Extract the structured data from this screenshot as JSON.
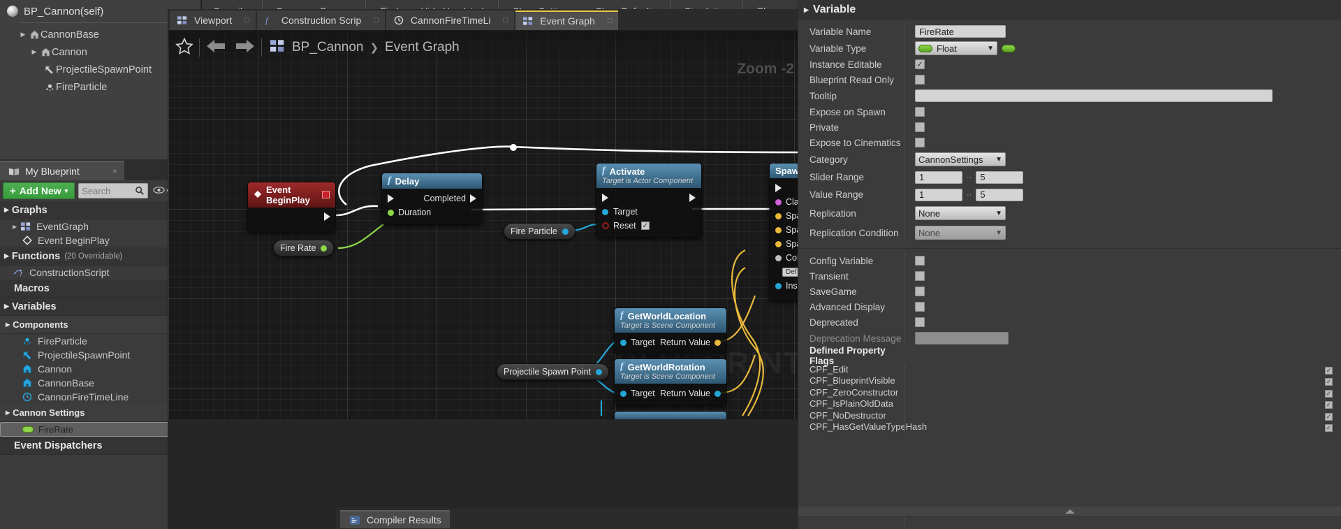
{
  "components_panel": {
    "root_label": "BP_Cannon(self)",
    "tree": [
      {
        "label": "CannonBase",
        "indent": 1,
        "icon": "component-icon",
        "arrow": true
      },
      {
        "label": "Cannon",
        "indent": 2,
        "icon": "component-icon",
        "arrow": true
      },
      {
        "label": "ProjectileSpawnPoint",
        "indent": 3,
        "icon": "arrow-icon",
        "arrow": false
      },
      {
        "label": "FireParticle",
        "indent": 3,
        "icon": "particle-icon",
        "arrow": false
      }
    ]
  },
  "my_blueprint": {
    "tab_label": "My Blueprint",
    "tab_close": "×",
    "add_new_label": "Add New",
    "add_new_plus": "+",
    "add_new_caret": "▾",
    "search_placeholder": "Search",
    "sections": [
      {
        "title": "Graphs",
        "sub": "",
        "plus": "+"
      },
      {
        "title": "Functions",
        "sub": "(20 Overridable)",
        "plus": "+"
      },
      {
        "title": "Macros",
        "sub": "",
        "plus": "+"
      },
      {
        "title": "Variables",
        "sub": "",
        "plus": "+"
      },
      {
        "title": "Event Dispatchers",
        "sub": "",
        "plus": "+"
      }
    ],
    "graphs": [
      {
        "label": "EventGraph",
        "icon": "graph-icon",
        "indent": 1
      },
      {
        "label": "Event BeginPlay",
        "icon": "event-node-icon",
        "indent": 2
      }
    ],
    "functions": [
      {
        "label": "ConstructionScript",
        "icon": "function-icon",
        "indent": 1
      }
    ],
    "components_group_label": "Components",
    "components_vars": [
      {
        "label": "FireParticle",
        "icon": "particle-icon"
      },
      {
        "label": "ProjectileSpawnPoint",
        "icon": "arrow-icon"
      },
      {
        "label": "Cannon",
        "icon": "component-icon"
      },
      {
        "label": "CannonBase",
        "icon": "component-icon"
      },
      {
        "label": "CannonFireTimeLine",
        "icon": "timeline-icon"
      }
    ],
    "cannon_settings_label": "Cannon Settings",
    "cannon_settings_vars": [
      {
        "label": "FireRate",
        "icon": "float-pill-icon",
        "selected": true,
        "eye": "eye-icon"
      }
    ]
  },
  "toolbar": {
    "items": [
      "Compile",
      "Save",
      "Browse",
      "Find",
      "Hide Unrelated",
      "Class Settings",
      "Class Defaults",
      "Simulation",
      "Play"
    ]
  },
  "graph_tabs": [
    {
      "label": "Viewport",
      "icon": "viewport-icon",
      "active": false
    },
    {
      "label": "Construction Scrip",
      "icon": "function-icon",
      "active": false
    },
    {
      "label": "CannonFireTimeLi",
      "icon": "clock-icon",
      "active": false
    },
    {
      "label": "Event Graph",
      "icon": "graph-icon",
      "active": true
    }
  ],
  "graph_toolbar": {
    "favorite_icon": "star-icon",
    "back_icon": "arrow-left-icon",
    "forward_icon": "arrow-right-icon",
    "breadcrumb_icon": "graph-icon",
    "breadcrumb": [
      "BP_Cannon",
      "Event Graph"
    ],
    "breadcrumb_sep": "❯",
    "zoom_label": "Zoom -2",
    "watermark": "BLUEPRINT"
  },
  "nodes": {
    "event_begin_play": {
      "title": "Event BeginPlay",
      "icon": "event-diamond-icon",
      "badge": "stop-badge",
      "header_color": "#8d2222"
    },
    "delay": {
      "title": "Delay",
      "icon": "function-f-icon",
      "clock_icon": "clock-icon",
      "header_color": "#3f6f8e",
      "pins_out": [
        "Completed"
      ],
      "pins_in": [
        "Duration"
      ]
    },
    "activate": {
      "title": "Activate",
      "subtitle": "Target is Actor Component",
      "icon": "function-f-icon",
      "header_color": "#3f6f8e",
      "pins": [
        {
          "label": "Target",
          "type": "object"
        },
        {
          "label": "Reset",
          "type": "bool",
          "checked": true
        }
      ]
    },
    "spawn_actor": {
      "title": "Spaw",
      "header_color": "#3f6f8e",
      "pins": [
        "Class",
        "Spaw",
        "Spaw",
        "Spaw",
        "Collis",
        "Insta"
      ],
      "dropdown_value": "Def"
    },
    "get_world_location": {
      "title": "GetWorldLocation",
      "subtitle": "Target is Scene Component",
      "icon": "function-f-icon",
      "header_color": "#3f6f8e",
      "pin_in": "Target",
      "pin_out": "Return Value"
    },
    "get_world_rotation": {
      "title": "GetWorldRotation",
      "subtitle": "Target is Scene Component",
      "icon": "function-f-icon",
      "header_color": "#3f6f8e",
      "pin_in": "Target",
      "pin_out": "Return Value"
    },
    "fire_rate_bubble": {
      "label": "Fire Rate"
    },
    "fire_particle_bubble": {
      "label": "Fire Particle"
    },
    "projectile_spawn_point_bubble": {
      "label": "Projectile Spawn Point"
    }
  },
  "compiler_results": {
    "tab_label": "Compiler Results",
    "icon": "results-icon"
  },
  "details": {
    "section_title": "Variable",
    "rows": [
      {
        "label": "Variable Name",
        "kind": "text",
        "value": "FireRate"
      },
      {
        "label": "Variable Type",
        "kind": "type",
        "value": "Float"
      },
      {
        "label": "Instance Editable",
        "kind": "check",
        "checked": true
      },
      {
        "label": "Blueprint Read Only",
        "kind": "check",
        "checked": false
      },
      {
        "label": "Tooltip",
        "kind": "text",
        "value": ""
      },
      {
        "label": "Expose on Spawn",
        "kind": "check",
        "checked": false
      },
      {
        "label": "Private",
        "kind": "check",
        "checked": false
      },
      {
        "label": "Expose to Cinematics",
        "kind": "check",
        "checked": false
      },
      {
        "label": "Category",
        "kind": "select",
        "value": "CannonSettings"
      },
      {
        "label": "Slider Range",
        "kind": "range",
        "min": "1",
        "max": "5"
      },
      {
        "label": "Value Range",
        "kind": "range",
        "min": "1",
        "max": "5"
      },
      {
        "label": "Replication",
        "kind": "select",
        "value": "None"
      },
      {
        "label": "Replication Condition",
        "kind": "select-disabled",
        "value": "None"
      }
    ],
    "rows2": [
      {
        "label": "Config Variable",
        "kind": "check",
        "checked": false
      },
      {
        "label": "Transient",
        "kind": "check",
        "checked": false
      },
      {
        "label": "SaveGame",
        "kind": "check",
        "checked": false
      },
      {
        "label": "Advanced Display",
        "kind": "check",
        "checked": false
      },
      {
        "label": "Deprecated",
        "kind": "check",
        "checked": false
      },
      {
        "label": "Deprecation Message",
        "kind": "text-readonly",
        "value": "",
        "dim": true
      }
    ],
    "flags_title": "Defined Property Flags",
    "flags": [
      "CPF_Edit",
      "CPF_BlueprintVisible",
      "CPF_ZeroConstructor",
      "CPF_IsPlainOldData",
      "CPF_NoDestructor",
      "CPF_HasGetValueTypeHash"
    ],
    "range_sep": "··",
    "collapse_icon": "collapse-triangle-icon"
  },
  "colors": {
    "accent_green": "#4caf50",
    "tab_active": "#e8c84a",
    "node_blue": "#3f6f8e",
    "node_red": "#8d2222",
    "exec_white": "#ffffff",
    "object_blue": "#24a7d8",
    "float_green": "#8ed64a",
    "yellow_wire": "#e8b93a"
  }
}
